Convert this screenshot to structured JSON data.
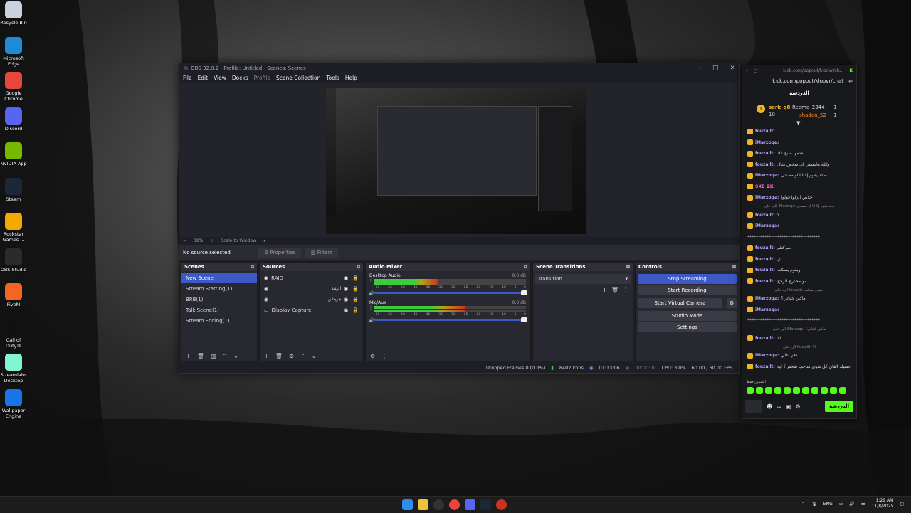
{
  "desktop": {
    "icons": [
      {
        "label": "Recycle Bin",
        "icon": "recycle-bin-icon",
        "color": "#c8d3df"
      },
      {
        "label": "Microsoft Edge",
        "icon": "edge-icon",
        "color": "#1f8ad8"
      },
      {
        "label": "Google Chrome",
        "icon": "chrome-icon",
        "color": "#e8453c"
      },
      {
        "label": "Discord",
        "icon": "discord-icon",
        "color": "#5865f2"
      },
      {
        "label": "NVIDIA App",
        "icon": "nvidia-icon",
        "color": "#76b900"
      },
      {
        "label": "Steam",
        "icon": "steam-icon",
        "color": "#1b2838"
      },
      {
        "label": "Rockstar Games ...",
        "icon": "rockstar-icon",
        "color": "#f5a800"
      },
      {
        "label": "OBS Studio",
        "icon": "obs-icon",
        "color": "#2b2b2b"
      },
      {
        "label": "FiveM",
        "icon": "fivem-icon",
        "color": "#f26522"
      },
      {
        "label": "Call of Duty®",
        "icon": "cod-icon",
        "color": "#111111"
      },
      {
        "label": "Streamlabs Desktop",
        "icon": "streamlabs-icon",
        "color": "#80f5d2"
      },
      {
        "label": "Wallpaper Engine",
        "icon": "wallpaper-engine-icon",
        "color": "#1a73e8"
      }
    ]
  },
  "obs": {
    "title": "OBS 32.0.2 - Profile: Untitled - Scenes: Scenes",
    "menu": [
      "File",
      "Edit",
      "View",
      "Docks",
      "Profile",
      "Scene Collection",
      "Tools",
      "Help"
    ],
    "preview_bar": {
      "minus": "−",
      "zoom": "38%",
      "plus": "+",
      "scale_mode": "Scale to Window"
    },
    "context": {
      "no_source": "No source selected",
      "properties": "Properties",
      "filters": "Filters"
    },
    "scenes": {
      "title": "Scenes",
      "items": [
        "New Scene",
        "Stream Starting(1)",
        "BRB(1)",
        "Talk Scene(1)",
        "Stream Ending(1)"
      ]
    },
    "sources": {
      "title": "Sources",
      "items": [
        "RAID",
        "الرئيد",
        "جريشن",
        "Display Capture"
      ]
    },
    "audio": {
      "title": "Audio Mixer",
      "channels": [
        {
          "name": "Desktop Audio",
          "db": "0.0 dB",
          "level": 0.42
        },
        {
          "name": "Mic/Aux",
          "db": "0.0 dB",
          "level": 0.6
        }
      ],
      "scale": [
        "-60",
        "-55",
        "-50",
        "-45",
        "-40",
        "-35",
        "-30",
        "-25",
        "-20",
        "-15",
        "-10",
        "-5",
        "0"
      ]
    },
    "transitions": {
      "title": "Scene Transitions",
      "selected": "Transition"
    },
    "controls": {
      "title": "Controls",
      "buttons": [
        "Stop Streaming",
        "Start Recording",
        "Start Virtual Camera",
        "Studio Mode",
        "Settings"
      ]
    },
    "status": {
      "dropped": "Dropped Frames 0 (0.0%)",
      "kbps": "8402 kbps",
      "live_time": "01:13:06",
      "rec_time": "00:00:00",
      "cpu": "CPU: 3.0%",
      "fps": "60.00 / 60.00 FPS"
    }
  },
  "kick": {
    "title_url": "kick.com/popout/kloovr/ch...",
    "url": "kick.com/popout/kloovr/chat",
    "header": "الدردشة",
    "top": [
      {
        "name": "sark_q8",
        "count": "10"
      },
      {
        "name": "Reema_2344",
        "count": "1"
      },
      {
        "name": "shaden_52",
        "count": "1"
      }
    ],
    "messages": [
      {
        "user": "fouzallt:",
        "text": "",
        "cls": "u1"
      },
      {
        "user": "iMarzoqa:",
        "text": "",
        "cls": "u1"
      },
      {
        "user": "fouzallt:",
        "text": "يقدمها صبح عاد",
        "cls": "u1"
      },
      {
        "user": "fouzallt:",
        "text": "والله مايمشي اي شخص مثال",
        "cls": "u1"
      },
      {
        "user": "iMarzoqa:",
        "text": "محد يقوم إلا انا او مصحى",
        "cls": "u1"
      },
      {
        "user": "SXB_ZK:",
        "text": "",
        "cls": "u2"
      },
      {
        "user": "iMarzoqa:",
        "text": "خلاص انزلوا قولوا",
        "cls": "u1"
      },
      {
        "reply": "الرد على iMarzoqa: محد يقوم إلا انا او مصحى"
      },
      {
        "user": "fouzallt:",
        "text": "؟",
        "cls": "u1"
      },
      {
        "user": "iMarzoqa:",
        "text": "",
        "cls": "u1"
      },
      {
        "user": "",
        "text": "**********************************",
        "cls": "u1"
      },
      {
        "user": "fouzallt:",
        "text": "مبركتلم",
        "cls": "u1"
      },
      {
        "user": "fouzallt:",
        "text": "اي",
        "cls": "u1"
      },
      {
        "user": "fouzallt:",
        "text": "ويقوم يسكت",
        "cls": "u1"
      },
      {
        "user": "fouzallt:",
        "text": "مو محدرج الرجح",
        "cls": "u1"
      },
      {
        "reply": "الرد على fouzallt: ويقوم يسكت"
      },
      {
        "user": "iMarzoqa:",
        "text": "ماكين كثثاثي؟",
        "cls": "u1"
      },
      {
        "user": "iMarzoqa:",
        "text": "",
        "cls": "u1"
      },
      {
        "user": "",
        "text": "**********************************",
        "cls": "u1"
      },
      {
        "reply": "الرد على iMarzoqa: ماكين كثثاثي؟"
      },
      {
        "user": "fouzallt:",
        "text": "الا",
        "cls": "u1"
      },
      {
        "reply": "الرد على fouzallt: الا"
      },
      {
        "user": "iMarzoqa:",
        "text": "دفي علي",
        "cls": "u1"
      },
      {
        "user": "fouzallt:",
        "text": "عشيك القاي كل شوي ساحب شخص؟ ليه",
        "cls": "u1"
      }
    ],
    "pinned_label": "المثبتين فقط",
    "send": "الدردشة"
  },
  "taskbar": {
    "lang": "ENG",
    "time": "1:29 AM",
    "date": "11/8/2025"
  }
}
